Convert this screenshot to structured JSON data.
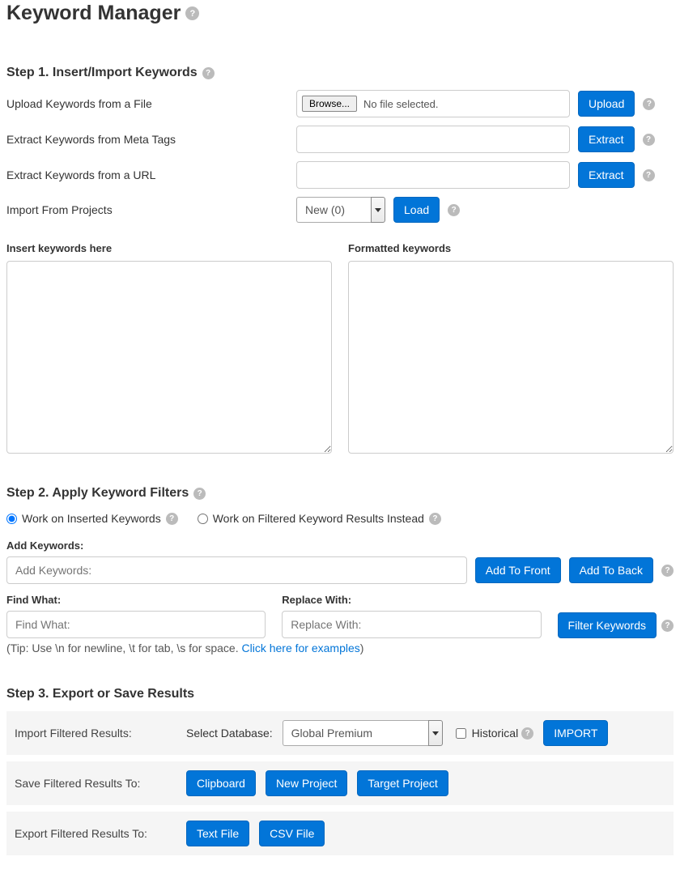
{
  "page": {
    "title": "Keyword Manager"
  },
  "step1": {
    "heading": "Step 1. Insert/Import Keywords",
    "uploadLabel": "Upload Keywords from a File",
    "browse": "Browse...",
    "noFile": "No file selected.",
    "uploadBtn": "Upload",
    "metaLabel": "Extract Keywords from Meta Tags",
    "urlLabel": "Extract Keywords from a URL",
    "extractBtn": "Extract",
    "importLabel": "Import From Projects",
    "projectSelected": "New (0)",
    "loadBtn": "Load",
    "insertHereLabel": "Insert keywords here",
    "formattedLabel": "Formatted keywords"
  },
  "step2": {
    "heading": "Step 2. Apply Keyword Filters",
    "optInserted": "Work on Inserted Keywords",
    "optFiltered": "Work on Filtered Keyword Results Instead",
    "addKeywordsLabel": "Add Keywords:",
    "addKeywordsPlaceholder": "Add Keywords:",
    "addFrontBtn": "Add To Front",
    "addBackBtn": "Add To Back",
    "findLabel": "Find What:",
    "findPlaceholder": "Find What:",
    "replaceLabel": "Replace With:",
    "replacePlaceholder": "Replace With:",
    "filterBtn": "Filter Keywords",
    "tipPrefix": "(Tip: Use \\n for newline, \\t for tab, \\s for space.  ",
    "tipLink": "Click here for examples",
    "tipSuffix": ")"
  },
  "step3": {
    "heading": "Step 3. Export or Save Results",
    "rowImportLabel": "Import Filtered Results:",
    "selectDbLabel": "Select Database:",
    "dbSelected": "Global Premium",
    "historicalLabel": "Historical",
    "importBtn": "IMPORT",
    "rowSaveLabel": "Save Filtered Results To:",
    "clipboardBtn": "Clipboard",
    "newProjectBtn": "New Project",
    "targetProjectBtn": "Target Project",
    "rowExportLabel": "Export Filtered Results To:",
    "textFileBtn": "Text File",
    "csvFileBtn": "CSV File"
  }
}
